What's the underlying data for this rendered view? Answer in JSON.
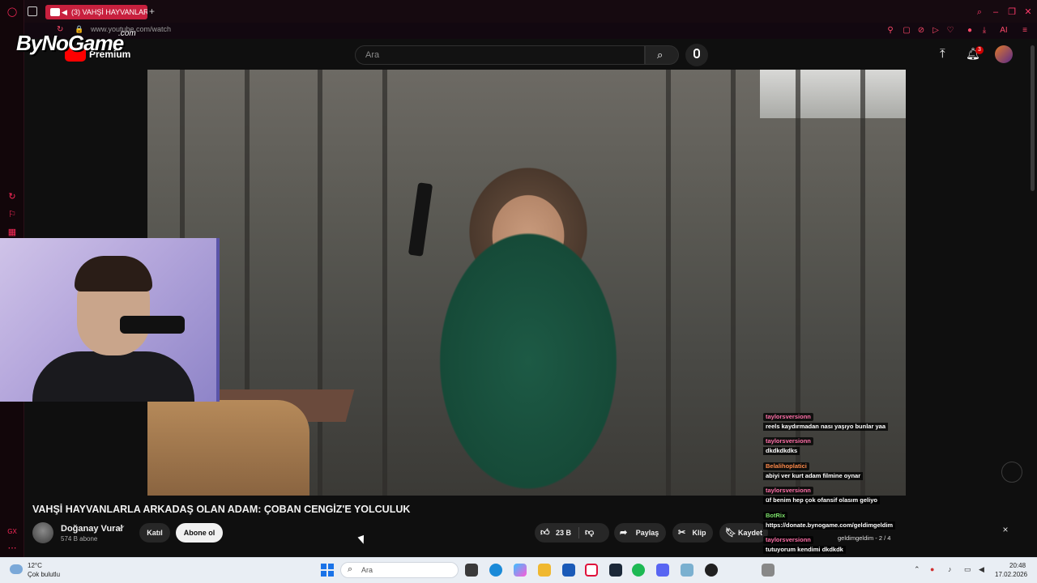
{
  "browser": {
    "tab_title": "(3) VAHŞİ HAYVANLAR",
    "new_tab": "+",
    "url": "www.youtube.com/watch"
  },
  "overlay": {
    "logo_text": "ByNoGame",
    "logo_suffix": ".com"
  },
  "youtube": {
    "logo_text": "Premium",
    "search_placeholder": "Ara",
    "notification_count": "3"
  },
  "video": {
    "title": "VAHŞİ HAYVANLARLA ARKADAŞ OLAN ADAM: ÇOBAN CENGİZ'E YOLCULUK",
    "channel_name": "Doğanay Vural",
    "subscribers": "574 B abone",
    "join_label": "Katıl",
    "subscribe_label": "Abone ol",
    "likes": "23 B",
    "share_label": "Paylaş",
    "clip_label": "Klip",
    "save_label": "Kaydet"
  },
  "chat": {
    "messages": [
      {
        "user": "taylorsversionn",
        "text": "reels kaydırmadan nası yaşıyo bunlar yaa"
      },
      {
        "user": "taylorsversionn",
        "text": "dkdkdkdks"
      },
      {
        "user": "Belalihoplatici",
        "text": "abiyi ver kurt adam filmine oynar"
      },
      {
        "user": "taylorsversionn",
        "text": "üf benim hep çok ofansif olasım geliyo"
      },
      {
        "user": "BotRix",
        "text": "https://donate.bynogame.com/geldimgeldim"
      },
      {
        "user": "taylorsversionn",
        "text": "tutuyorum kendimi dkdkdk"
      }
    ],
    "counter": "geldimgeldim - 2 / 4",
    "close": "×"
  },
  "taskbar": {
    "temperature": "12°C",
    "weather": "Çok bulutlu",
    "search_placeholder": "Ara",
    "time": "20:48",
    "date": "17.02.2026"
  },
  "colors": {
    "gx_accent": "#ff2a5a",
    "tab_active": "#c8203e",
    "youtube_red": "#ff0000",
    "subscribe_bg": "#f1f1f1"
  }
}
